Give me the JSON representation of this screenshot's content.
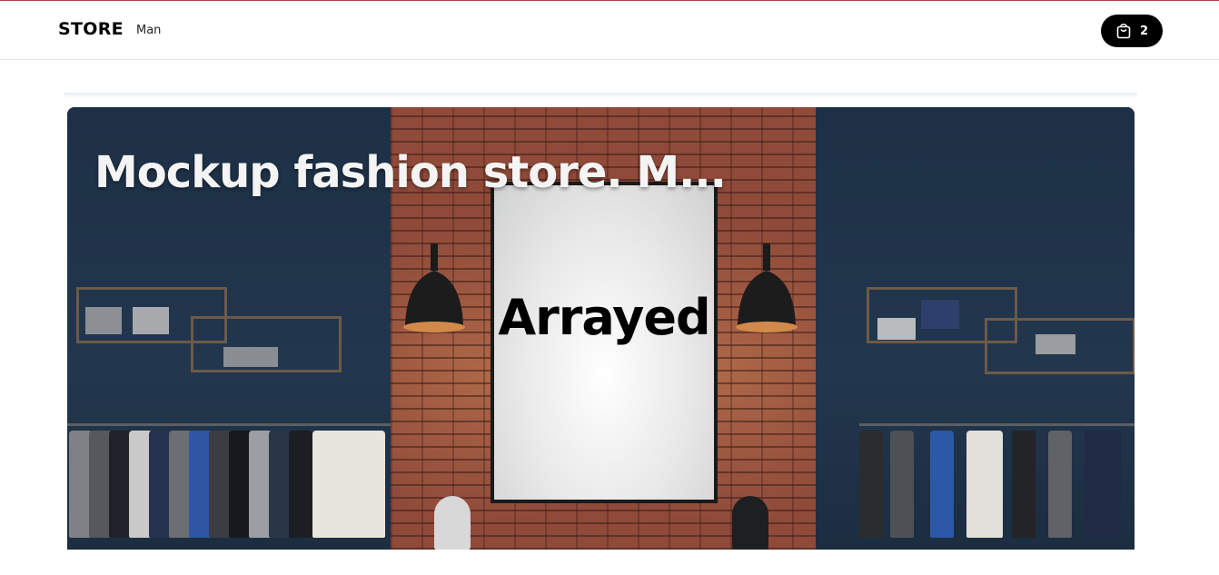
{
  "header": {
    "brand": "STORE",
    "nav": [
      {
        "label": "Man"
      }
    ],
    "cart": {
      "icon": "shopping-bag-icon",
      "count": "2"
    }
  },
  "hero": {
    "overlay_title": "Mockup fashion store. M...",
    "poster_text": "Arrayed"
  },
  "colors": {
    "accent_top": "#b0414a",
    "cart_bg": "#000000",
    "wall": "#1d3046",
    "brick": "#8f4a3a"
  }
}
